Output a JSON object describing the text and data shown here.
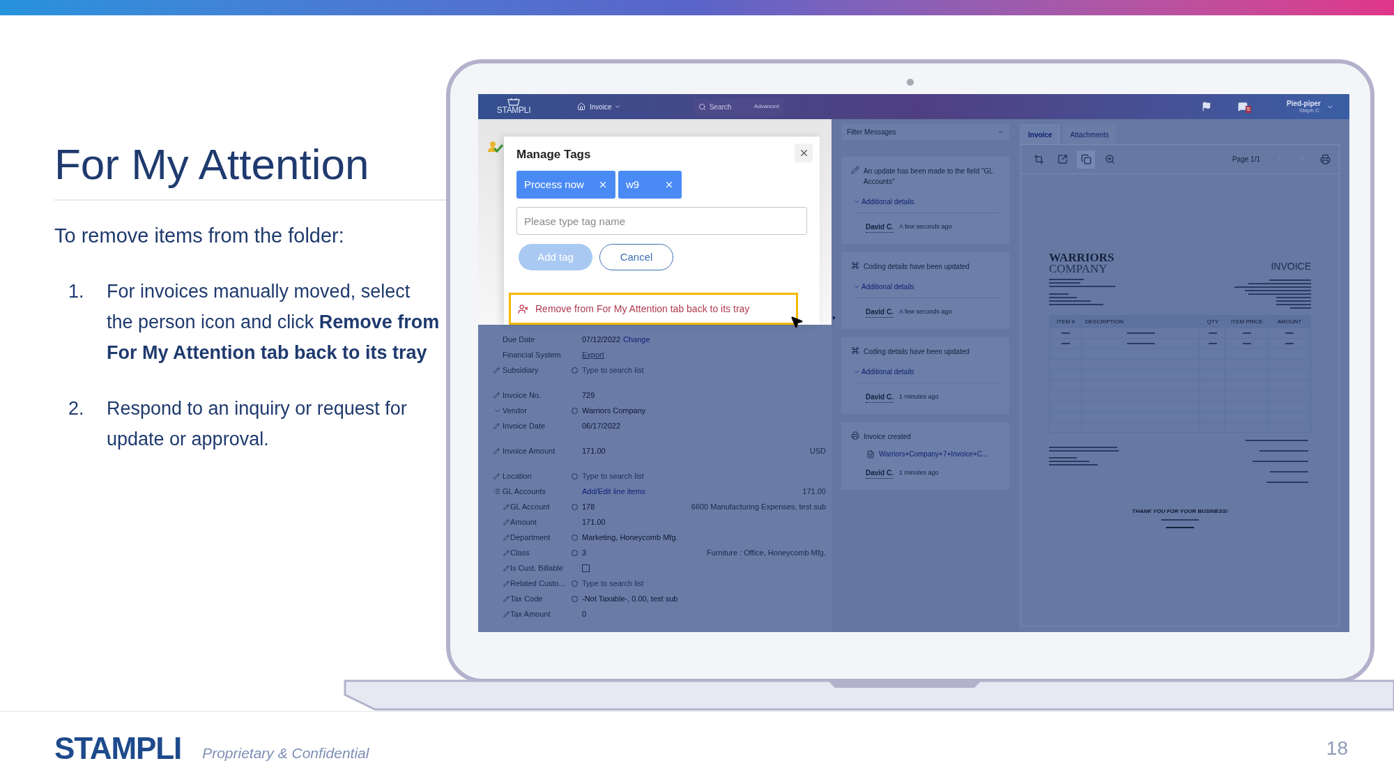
{
  "slide": {
    "title": "For My Attention",
    "intro": "To remove items from the folder:",
    "steps": [
      {
        "number": "1.",
        "text": "For invoices manually moved, select the person icon and click **Remove from For My Attention tab back to its tray**"
      },
      {
        "number": "2.",
        "text": "Respond to an inquiry or request for update or approval."
      }
    ]
  },
  "app": {
    "header": {
      "logo": "STAMPLI",
      "menu": "Invoice",
      "search_placeholder": "Search",
      "search_link": "Advanced",
      "notification_count": "5",
      "company": "Pied-piper",
      "user": "Steph C."
    },
    "dialog": {
      "title": "Manage Tags",
      "tags": [
        {
          "label": "Process now"
        },
        {
          "label": "w9"
        }
      ],
      "input_placeholder": "Please type tag name",
      "buttons": [
        {
          "label": "Add tag",
          "disabled": true
        },
        {
          "label": "Cancel",
          "disabled": false
        }
      ],
      "menu_item": {
        "label": "Remove from For My Attention tab back to its tray",
        "highlighted": true
      }
    },
    "form_groups": [
      [
        {
          "editable": false,
          "expandable": false,
          "label": "Due Date",
          "lookup": false,
          "value": "07/12/2022",
          "kind": "text",
          "link": "Change"
        },
        {
          "editable": false,
          "expandable": false,
          "label": "Financial System",
          "lookup": false,
          "value": "Export",
          "kind": "muted"
        },
        {
          "editable": true,
          "expandable": false,
          "label": "Subsidiary",
          "lookup": true,
          "value": "Type to search list",
          "kind": "placeholder"
        }
      ],
      [
        {
          "editable": true,
          "expandable": false,
          "label": "Invoice No.",
          "lookup": false,
          "value": "729",
          "kind": "text"
        },
        {
          "expandable": true,
          "label": "Vendor",
          "lookup": true,
          "value": "Warriors Company",
          "kind": "text"
        },
        {
          "editable": true,
          "expandable": false,
          "label": "Invoice Date",
          "lookup": false,
          "value": "06/17/2022",
          "kind": "text"
        }
      ],
      [
        {
          "editable": true,
          "expandable": false,
          "label": "Invoice Amount",
          "lookup": false,
          "value": "171.00",
          "kind": "text",
          "aside": "USD"
        }
      ],
      [
        {
          "editable": true,
          "expandable": false,
          "label": "Location",
          "lookup": true,
          "value": "Type to search list",
          "kind": "placeholder"
        },
        {
          "expandable": true,
          "label": "GL Accounts",
          "lookup": false,
          "value": "Add/Edit line items",
          "kind": "link",
          "aside": "171.00",
          "children": [
            {
              "editable": true,
              "expandable": false,
              "label": "GL Account",
              "lookup": true,
              "value": "178",
              "kind": "text",
              "aside": "6600 Manufacturing Expenses, test sub"
            },
            {
              "editable": true,
              "expandable": false,
              "label": "Amount",
              "lookup": false,
              "value": "171.00",
              "kind": "text"
            },
            {
              "editable": true,
              "expandable": false,
              "label": "Department",
              "lookup": true,
              "value": "Marketing, Honeycomb Mfg.",
              "kind": "text"
            },
            {
              "editable": true,
              "expandable": false,
              "label": "Class",
              "lookup": true,
              "value": "3",
              "kind": "text",
              "aside": "Furniture : Office, Honeycomb Mfg."
            },
            {
              "editable": true,
              "expandable": false,
              "label": "Is Cust. Billable",
              "lookup": false,
              "kind": "checkbox",
              "checked": false
            },
            {
              "editable": true,
              "expandable": false,
              "label": "Related Custo...",
              "lookup": true,
              "value": "Type to search list",
              "kind": "placeholder"
            },
            {
              "editable": true,
              "expandable": false,
              "label": "Tax Code",
              "lookup": true,
              "value": "-Not Taxable-, 0.00, test sub",
              "kind": "text"
            },
            {
              "editable": true,
              "expandable": false,
              "label": "Tax Amount",
              "lookup": false,
              "value": "0",
              "kind": "text"
            }
          ]
        }
      ]
    ],
    "messages": {
      "filter": "Filter Messages",
      "items": [
        {
          "kind": "update",
          "text": "An update has been made to the field \"GL Accounts\"",
          "details": "Additional details",
          "author": "David C.",
          "time": "A few seconds ago"
        },
        {
          "kind": "coding",
          "text": "Coding details have been updated",
          "details": "Additional details",
          "author": "David C.",
          "time": "A few seconds ago"
        },
        {
          "kind": "coding",
          "text": "Coding details have been updated",
          "details": "Additional details",
          "author": "David C.",
          "time": "1 minutes ago"
        },
        {
          "kind": "created",
          "text": "Invoice created",
          "file": "Warriors+Company+7+Invoice+C...",
          "author": "David C.",
          "time": "1 minutes ago"
        }
      ]
    },
    "viewer": {
      "tabs": [
        {
          "label": "Invoice",
          "selected": true
        },
        {
          "label": "Attachments",
          "selected": false
        }
      ],
      "tools": [
        {
          "kind": "crop",
          "selected": false
        },
        {
          "kind": "open",
          "selected": false
        },
        {
          "kind": "copy",
          "selected": true
        },
        {
          "kind": "zoom",
          "selected": false
        }
      ],
      "page": "Page 1/1",
      "document": {
        "company_line1": "WARRIORS",
        "company_line2": "COMPANY",
        "heading": "INVOICE",
        "columns": [
          "ITEM #",
          "DESCRIPTION",
          "QTY",
          "ITEM PRICE",
          "AMOUNT"
        ],
        "closing": "THANK YOU FOR YOUR BUSINESS!"
      }
    }
  },
  "footer": {
    "logo": "STAMPLI",
    "note": "Proprietary & Confidential",
    "page": "18"
  }
}
